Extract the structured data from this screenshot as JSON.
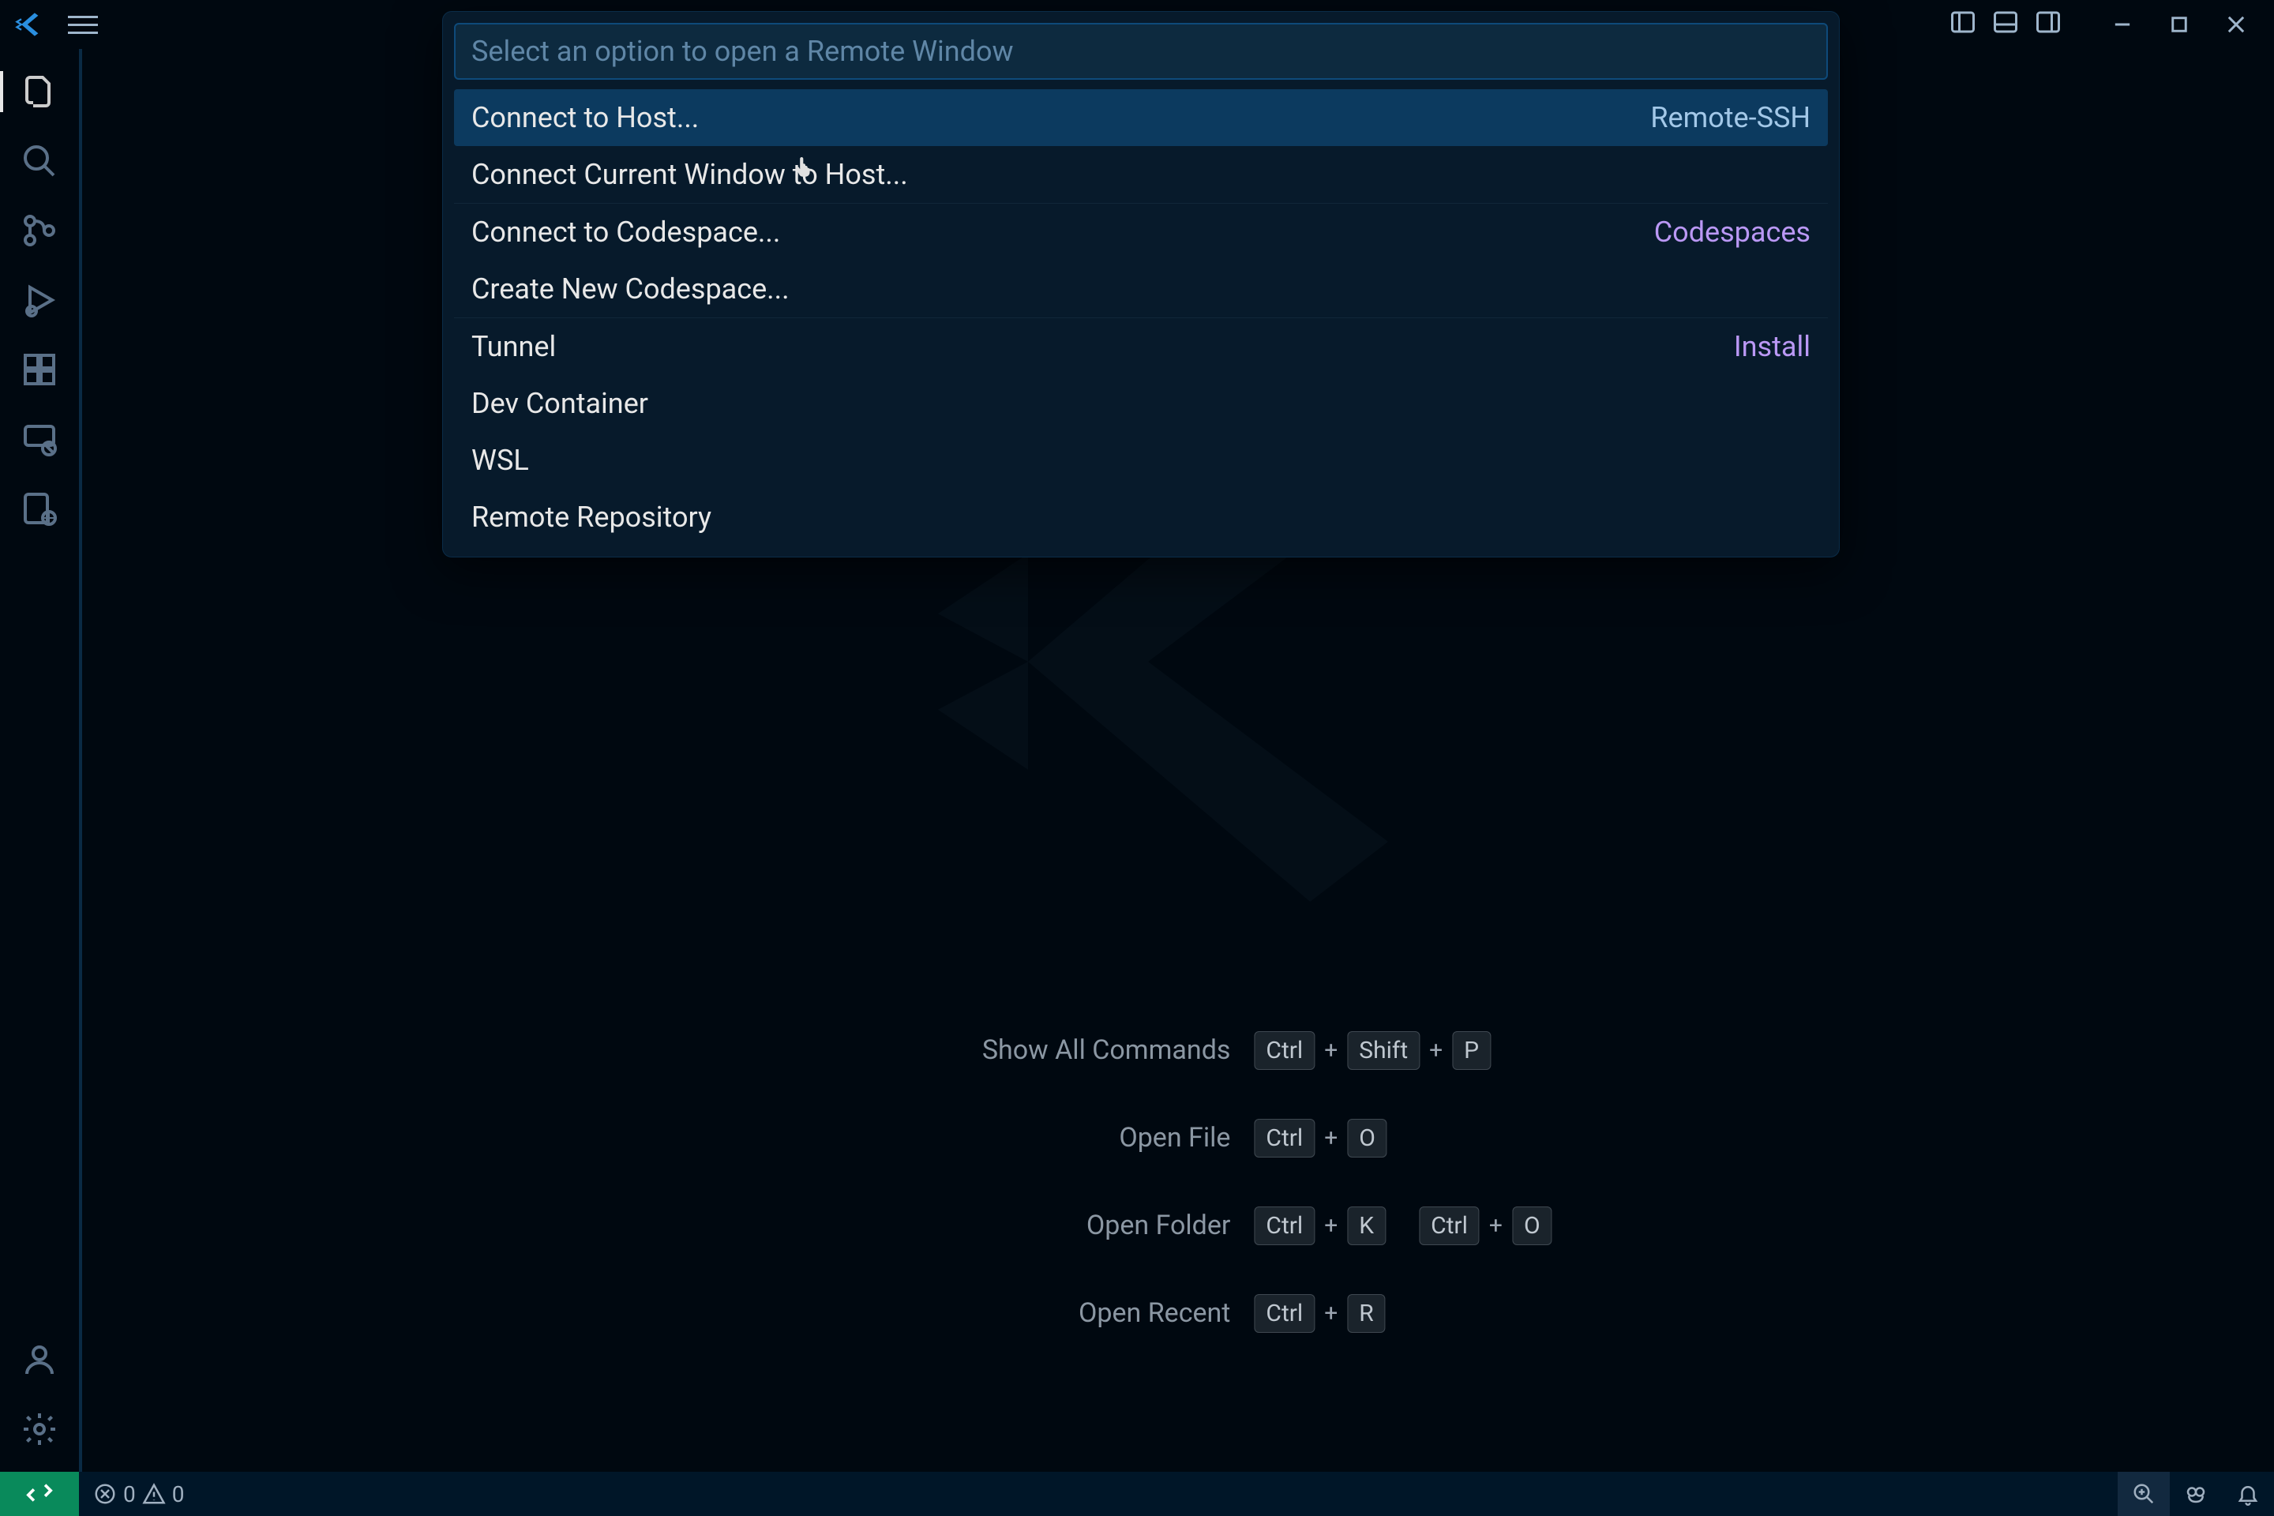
{
  "quickpick": {
    "placeholder": "Select an option to open a Remote Window",
    "items": [
      {
        "label": "Connect to Host...",
        "detail": "Remote-SSH",
        "detail_class": "ssh"
      },
      {
        "label": "Connect Current Window to Host...",
        "detail": ""
      },
      {
        "label": "Connect to Codespace...",
        "detail": "Codespaces"
      },
      {
        "label": "Create New Codespace...",
        "detail": ""
      },
      {
        "label": "Tunnel",
        "detail": "Install"
      },
      {
        "label": "Dev Container",
        "detail": ""
      },
      {
        "label": "WSL",
        "detail": ""
      },
      {
        "label": "Remote Repository",
        "detail": ""
      }
    ]
  },
  "shortcuts": {
    "show_all_commands": {
      "label": "Show All Commands",
      "keys": [
        "Ctrl",
        "Shift",
        "P"
      ]
    },
    "open_file": {
      "label": "Open File",
      "keys": [
        "Ctrl",
        "O"
      ]
    },
    "open_folder": {
      "label": "Open Folder",
      "keys": [
        "Ctrl",
        "K",
        "Ctrl",
        "O"
      ]
    },
    "open_recent": {
      "label": "Open Recent",
      "keys": [
        "Ctrl",
        "R"
      ]
    }
  },
  "status": {
    "errors": "0",
    "warnings": "0"
  }
}
